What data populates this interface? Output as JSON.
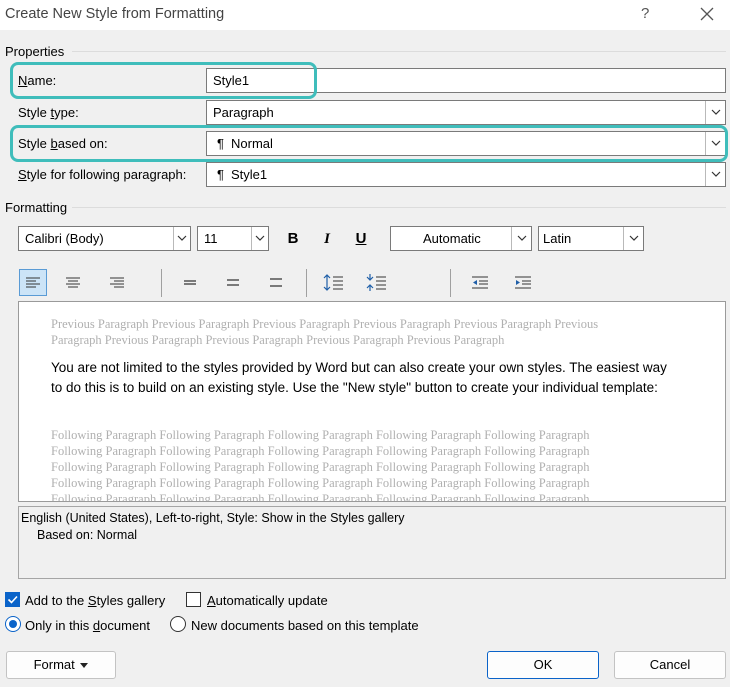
{
  "window": {
    "title": "Create New Style from Formatting",
    "help_label": "?",
    "close_label": "close"
  },
  "properties": {
    "group_label": "Properties",
    "name": {
      "label": "Name:",
      "value": "Style1"
    },
    "style_type": {
      "label": "Style type:",
      "value": "Paragraph"
    },
    "style_based_on": {
      "label": "Style based on:",
      "value": "Normal"
    },
    "following": {
      "label": "Style for following paragraph:",
      "value": "Style1"
    },
    "pilcrow": "¶"
  },
  "formatting": {
    "group_label": "Formatting",
    "font": "Calibri (Body)",
    "size": "11",
    "bold": "B",
    "italic": "I",
    "underline": "U",
    "color": "Automatic",
    "script": "Latin"
  },
  "preview": {
    "previous_1": "Previous Paragraph Previous Paragraph Previous Paragraph Previous Paragraph Previous Paragraph Previous",
    "previous_2": "Paragraph Previous Paragraph Previous Paragraph Previous Paragraph Previous Paragraph",
    "main_text": "You are not limited to the styles provided by Word but can also create your own styles. The easiest way to do this is to build on an existing style. Use the \"New style\" button to create your individual template:",
    "following": [
      "Following Paragraph Following Paragraph Following Paragraph Following Paragraph Following Paragraph",
      "Following Paragraph Following Paragraph Following Paragraph Following Paragraph Following Paragraph",
      "Following Paragraph Following Paragraph Following Paragraph Following Paragraph Following Paragraph",
      "Following Paragraph Following Paragraph Following Paragraph Following Paragraph Following Paragraph",
      "Following Paragraph Following Paragraph Following Paragraph Following Paragraph Following Paragraph"
    ]
  },
  "description": {
    "line1": "English (United States), Left-to-right, Style: Show in the Styles gallery",
    "line2": "Based on: Normal"
  },
  "options": {
    "add_to_gallery": {
      "label": "Add to the Styles gallery",
      "checked": true
    },
    "auto_update": {
      "label": "Automatically update",
      "checked": false
    },
    "only_this_doc": {
      "label": "Only in this document",
      "selected": true
    },
    "new_docs": {
      "label": "New documents based on this template",
      "selected": false
    }
  },
  "buttons": {
    "format": "Format",
    "ok": "OK",
    "cancel": "Cancel"
  },
  "colors": {
    "highlight": "#3fbdbb",
    "accent": "#0a63c9"
  }
}
